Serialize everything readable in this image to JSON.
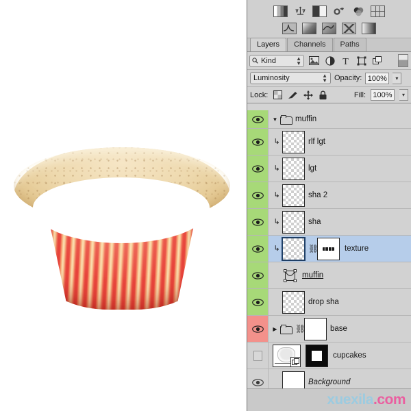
{
  "canvas": {
    "name": "cupcake-artwork",
    "description": "Cupcake wrapper with muffin top"
  },
  "panel": {
    "adjustment_icons": [
      {
        "name": "levels-icon"
      },
      {
        "name": "curves-balance-icon"
      },
      {
        "name": "brightness-contrast-icon"
      },
      {
        "name": "exposure-icon"
      },
      {
        "name": "hue-saturation-icon"
      },
      {
        "name": "color-lookup-icon"
      }
    ],
    "style_icons": [
      {
        "name": "gradient-map-icon"
      },
      {
        "name": "photo-filter-icon"
      },
      {
        "name": "curves-icon"
      },
      {
        "name": "invert-icon"
      },
      {
        "name": "gradient-icon"
      }
    ],
    "tabs": [
      {
        "label": "Layers",
        "active": true
      },
      {
        "label": "Channels",
        "active": false
      },
      {
        "label": "Paths",
        "active": false
      }
    ],
    "filter": {
      "kind_label": "Kind",
      "search_icon": "magnifier-icon",
      "type_filters": [
        {
          "name": "filter-pixel-layers-icon"
        },
        {
          "name": "filter-adjustment-layers-icon"
        },
        {
          "name": "filter-type-layers-icon"
        },
        {
          "name": "filter-shape-layers-icon"
        },
        {
          "name": "filter-smart-object-layers-icon"
        }
      ],
      "toggle_name": "filter-enable-toggle"
    },
    "blend": {
      "mode": "Luminosity",
      "opacity_label": "Opacity:",
      "opacity_value": "100%"
    },
    "lock": {
      "label": "Lock:",
      "icons": [
        {
          "name": "lock-transparent-pixels-icon"
        },
        {
          "name": "lock-image-pixels-icon"
        },
        {
          "name": "lock-position-icon"
        },
        {
          "name": "lock-all-icon"
        }
      ],
      "fill_label": "Fill:",
      "fill_value": "100%"
    },
    "layers": [
      {
        "name": "muffin",
        "type": "group",
        "visible": true,
        "eye_color": "green",
        "expanded": true,
        "selected": false,
        "clipped": false,
        "has_mask": false,
        "underline": false,
        "italic": false
      },
      {
        "name": "rlf lgt",
        "type": "pixel",
        "visible": true,
        "eye_color": "green",
        "selected": false,
        "clipped": true,
        "has_mask": false,
        "thumb_variant": "empty",
        "underline": false,
        "italic": false
      },
      {
        "name": "lgt",
        "type": "pixel",
        "visible": true,
        "eye_color": "green",
        "selected": false,
        "clipped": true,
        "has_mask": false,
        "thumb_variant": "lgt",
        "underline": false,
        "italic": false
      },
      {
        "name": "sha 2",
        "type": "pixel",
        "visible": true,
        "eye_color": "green",
        "selected": false,
        "clipped": true,
        "has_mask": false,
        "thumb_variant": "sha2",
        "underline": false,
        "italic": false
      },
      {
        "name": "sha",
        "type": "pixel",
        "visible": true,
        "eye_color": "green",
        "selected": false,
        "clipped": true,
        "has_mask": false,
        "thumb_variant": "sha",
        "underline": false,
        "italic": false
      },
      {
        "name": "texture",
        "type": "pixel",
        "visible": true,
        "eye_color": "green",
        "selected": true,
        "clipped": true,
        "has_mask": true,
        "mask_variant": "strokes",
        "linked": true,
        "thumb_variant": "tex",
        "underline": false,
        "italic": false
      },
      {
        "name": "muffin",
        "type": "shape",
        "visible": true,
        "eye_color": "green",
        "selected": false,
        "clipped": false,
        "has_mask": false,
        "underline": true,
        "italic": false
      },
      {
        "name": "drop sha",
        "type": "pixel",
        "visible": true,
        "eye_color": "green",
        "selected": false,
        "clipped": false,
        "has_mask": false,
        "thumb_variant": "empty",
        "underline": false,
        "italic": false
      },
      {
        "name": "base",
        "type": "group",
        "visible": true,
        "eye_color": "red",
        "expanded": false,
        "selected": false,
        "clipped": false,
        "has_mask": false,
        "linked": true,
        "thumb_variant": "base",
        "underline": false,
        "italic": false
      },
      {
        "name": "cupcakes",
        "type": "smart-object",
        "visible": false,
        "eye_color": "gray",
        "selected": false,
        "clipped": false,
        "has_mask": true,
        "mask_variant": "black-white-center",
        "underline": false,
        "italic": false
      },
      {
        "name": "Background",
        "type": "background",
        "visible": true,
        "eye_color": "gray",
        "selected": false,
        "clipped": false,
        "has_mask": false,
        "thumb_variant": "white",
        "underline": false,
        "italic": true
      }
    ]
  },
  "watermark": {
    "part_a": "xuexila",
    "part_b": ".com",
    "color_a": "#9ccbe0",
    "color_b": "#ea5fa0"
  }
}
